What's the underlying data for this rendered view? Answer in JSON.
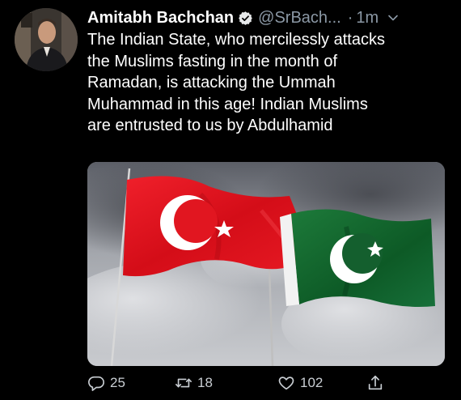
{
  "tweet": {
    "display_name": "Amitabh Bachchan",
    "handle": "@SrBach...",
    "time": "1m",
    "text_lines": [
      "The Indian State, who mercilessly attacks",
      "the Muslims fasting in the month of",
      "Ramadan, is attacking the Ummah",
      "Muhammad in this age! Indian Muslims",
      "are entrusted to us by Abdulhamid"
    ]
  },
  "actions": {
    "reply_count": "25",
    "retweet_count": "18",
    "like_count": "102"
  },
  "icons": {
    "verified": "verified-badge-icon",
    "chevron": "chevron-down-icon",
    "reply": "reply-icon",
    "retweet": "retweet-icon",
    "like": "heart-icon",
    "share": "share-icon"
  },
  "colors": {
    "background": "#000000",
    "text": "#ffffff",
    "secondary_text": "#8b98a5",
    "action_icons": "#c9ced3",
    "turkey_flag": "#e30a17",
    "pakistan_flag": "#01411c"
  }
}
